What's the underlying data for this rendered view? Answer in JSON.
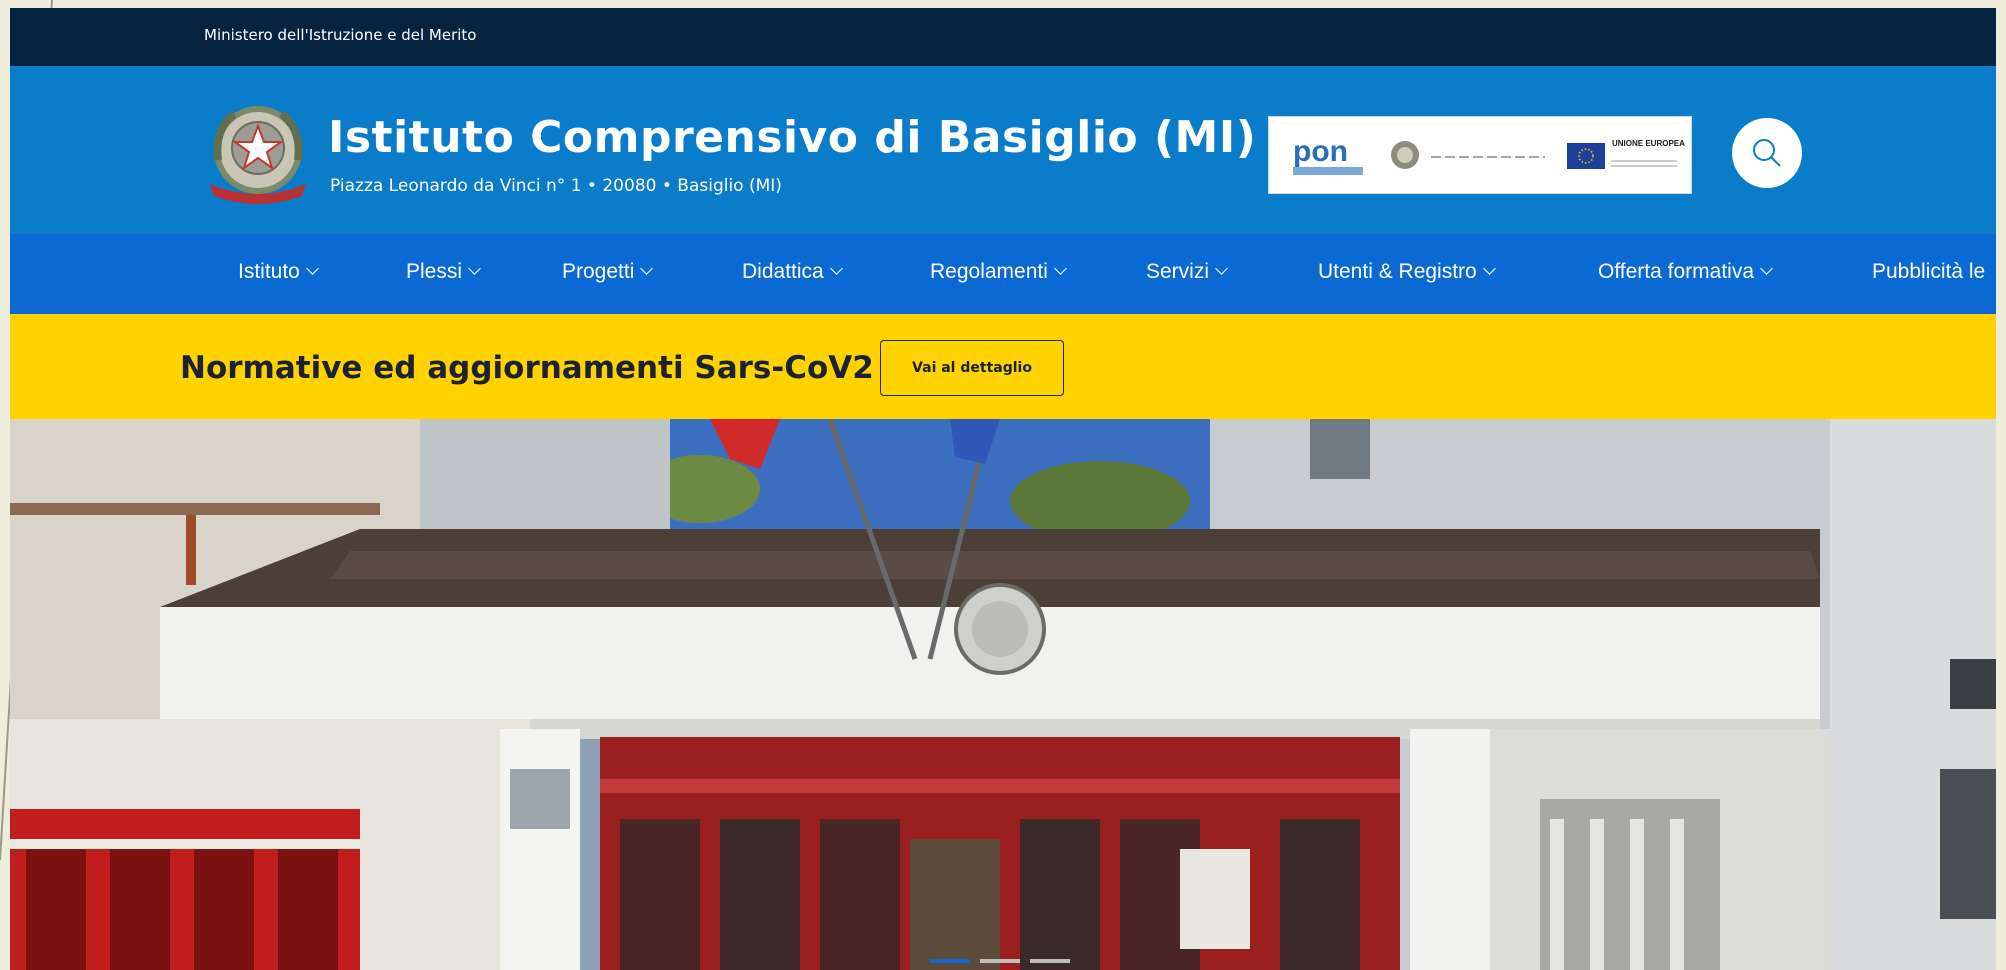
{
  "topbar": {
    "ministry": "Ministero dell'Istruzione e del Merito"
  },
  "header": {
    "title": "Istituto Comprensivo di Basiglio (MI)",
    "address": "Piazza Leonardo da Vinci n° 1 • 20080 • Basiglio (MI)",
    "pon_banner": {
      "pon_label": "pon",
      "eu_label": "UNIONE EUROPEA"
    },
    "search_icon": "search-icon",
    "emblem_icon": "republic-emblem-icon"
  },
  "nav": {
    "items": [
      {
        "label": "Istituto"
      },
      {
        "label": "Plessi"
      },
      {
        "label": "Progetti"
      },
      {
        "label": "Didattica"
      },
      {
        "label": "Regolamenti"
      },
      {
        "label": "Servizi"
      },
      {
        "label": "Utenti & Registro"
      },
      {
        "label": "Offerta formativa"
      },
      {
        "label": "Pubblicità le"
      }
    ]
  },
  "notice": {
    "text": "Normative ed aggiornamenti Sars-CoV2",
    "button_label": "Vai al dettaglio"
  },
  "carousel": {
    "slide_count": 3,
    "active_index": 0,
    "active_color": "#0b69d4"
  },
  "colors": {
    "topbar": "#06243f",
    "header": "#0a7cc9",
    "navbar": "#0b69d4",
    "notice": "#ffd200"
  }
}
